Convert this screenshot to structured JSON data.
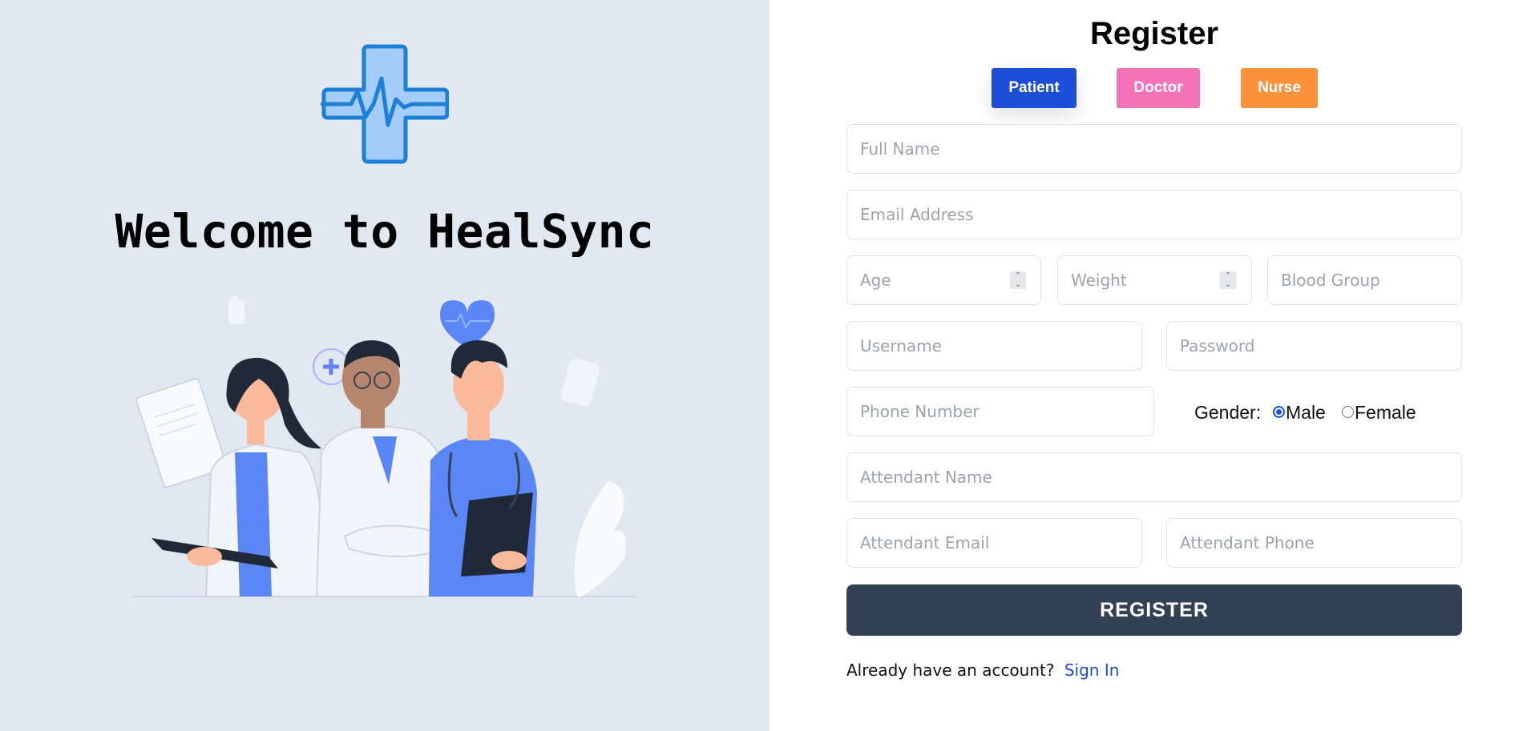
{
  "welcome": {
    "heading": "Welcome to HealSync"
  },
  "form": {
    "title": "Register",
    "roles": [
      {
        "label": "Patient",
        "color": "#1d4ed8",
        "selected": true
      },
      {
        "label": "Doctor",
        "color": "#f472b6",
        "selected": false
      },
      {
        "label": "Nurse",
        "color": "#fb923c",
        "selected": false
      }
    ],
    "fields": {
      "full_name": {
        "placeholder": "Full Name",
        "value": ""
      },
      "email": {
        "placeholder": "Email Address",
        "value": ""
      },
      "age": {
        "placeholder": "Age",
        "value": ""
      },
      "weight": {
        "placeholder": "Weight",
        "value": ""
      },
      "blood_group": {
        "placeholder": "Blood Group",
        "value": ""
      },
      "username": {
        "placeholder": "Username",
        "value": ""
      },
      "password": {
        "placeholder": "Password",
        "value": ""
      },
      "phone": {
        "placeholder": "Phone Number",
        "value": ""
      },
      "attendant_name": {
        "placeholder": "Attendant Name",
        "value": ""
      },
      "attendant_email": {
        "placeholder": "Attendant Email",
        "value": ""
      },
      "attendant_phone": {
        "placeholder": "Attendant Phone",
        "value": ""
      }
    },
    "gender": {
      "label": "Gender:",
      "options": [
        "Male",
        "Female"
      ],
      "selected": "Male"
    },
    "register_label": "REGISTER",
    "signin_prompt": "Already have an account?",
    "signin_link": "Sign In"
  },
  "colors": {
    "left_bg": "#e2e8f0",
    "register_btn": "#334155",
    "link": "#1d4ed8",
    "logo_fill": "#93c5fd",
    "logo_stroke": "#1e7fd6"
  },
  "icons": {
    "logo": "medical-cross-heartbeat-icon",
    "spinner": "number-spinner-icon"
  }
}
